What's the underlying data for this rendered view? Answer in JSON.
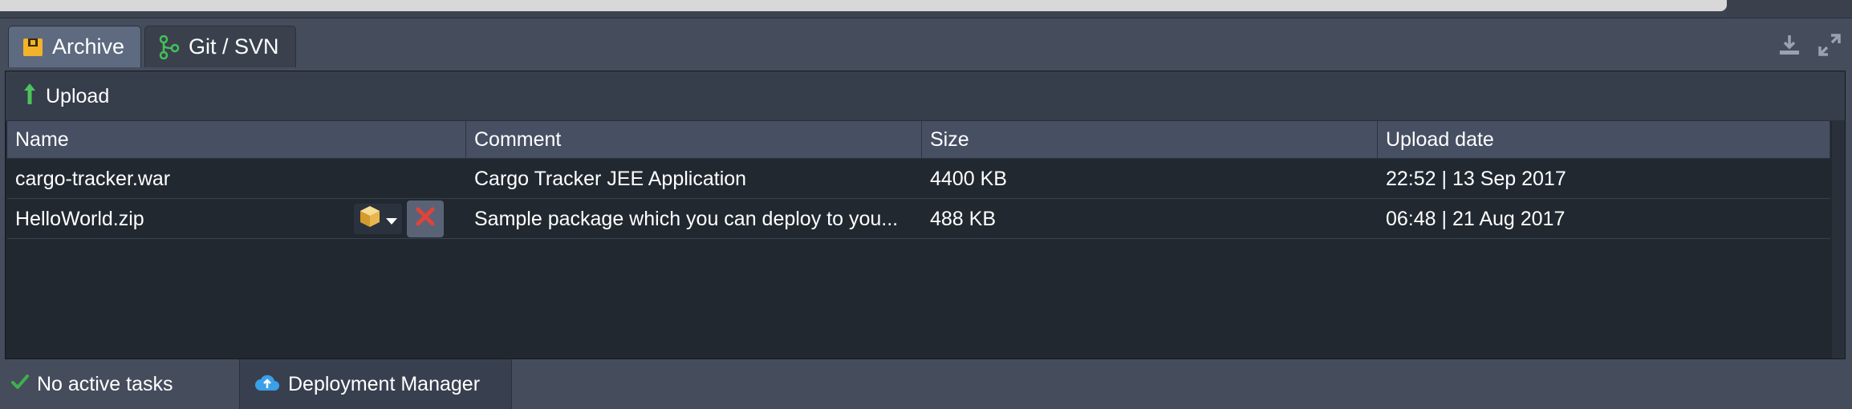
{
  "tabs": [
    {
      "label": "Archive",
      "icon": "archive-icon",
      "active": true
    },
    {
      "label": "Git / SVN",
      "icon": "git-branch-icon",
      "active": false
    }
  ],
  "corner": {
    "download_icon": "download-icon",
    "expand_icon": "expand-icon"
  },
  "toolbar": {
    "upload_label": "Upload",
    "upload_icon": "arrow-up-icon"
  },
  "table": {
    "columns": [
      "Name",
      "Comment",
      "Size",
      "Upload date"
    ],
    "rows": [
      {
        "name": "cargo-tracker.war",
        "comment": "Cargo Tracker JEE Application",
        "size": "4400 KB",
        "date": "22:52 | 13 Sep 2017"
      },
      {
        "name": "HelloWorld.zip",
        "comment": "Sample package which you can deploy to you...",
        "size": "488 KB",
        "date": "06:48 | 21 Aug 2017"
      }
    ]
  },
  "status": {
    "tasks_label": "No active tasks",
    "deployment_manager_label": "Deployment Manager"
  },
  "colors": {
    "background": "#454d5c",
    "panel": "#212830",
    "active_tab": "#5d6a80",
    "success_green": "#3fb04a",
    "delete_red": "#e0433a",
    "cloud_blue": "#3aa0e8"
  }
}
